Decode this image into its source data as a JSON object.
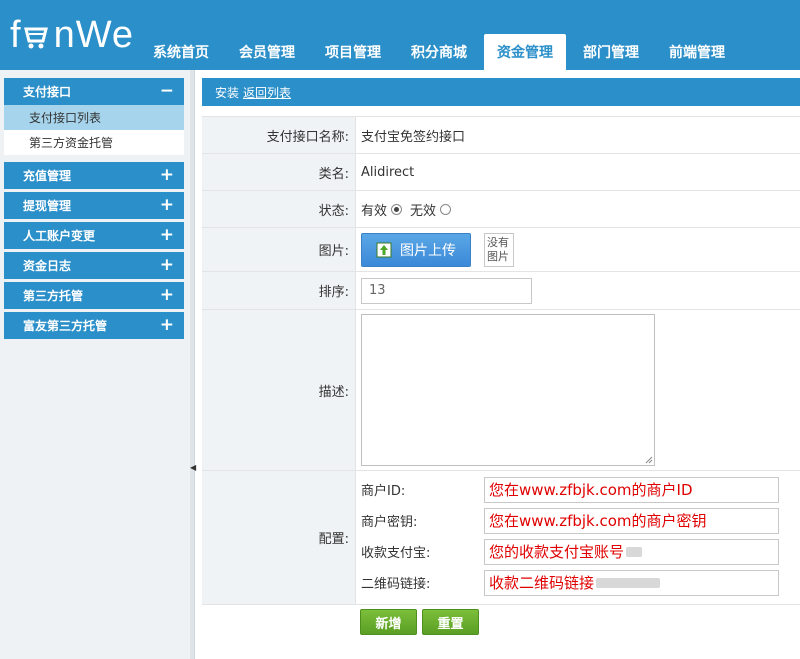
{
  "header": {
    "logo_text": "fanWe",
    "nav": [
      {
        "label": "系统首页",
        "active": false
      },
      {
        "label": "会员管理",
        "active": false
      },
      {
        "label": "项目管理",
        "active": false
      },
      {
        "label": "积分商城",
        "active": false
      },
      {
        "label": "资金管理",
        "active": true
      },
      {
        "label": "部门管理",
        "active": false
      },
      {
        "label": "前端管理",
        "active": false
      }
    ]
  },
  "sidebar": {
    "groups": [
      {
        "label": "支付接口",
        "sign": "−",
        "subs": [
          "支付接口列表",
          "第三方资金托管"
        ]
      },
      {
        "label": "充值管理",
        "sign": "+"
      },
      {
        "label": "提现管理",
        "sign": "+"
      },
      {
        "label": "人工账户变更",
        "sign": "+"
      },
      {
        "label": "资金日志",
        "sign": "+"
      },
      {
        "label": "第三方托管",
        "sign": "+"
      },
      {
        "label": "富友第三方托管",
        "sign": "+"
      }
    ]
  },
  "main": {
    "title_prefix": "安装",
    "back_link": "返回列表",
    "form": {
      "name_label": "支付接口名称:",
      "name_value": "支付宝免签约接口",
      "class_label": "类名:",
      "class_value": "Alidirect",
      "status_label": "状态:",
      "status_on": "有效",
      "status_off": "无效",
      "status_selected": "有效",
      "image_label": "图片:",
      "upload_label": "图片上传",
      "no_image_label": "没有图片",
      "sort_label": "排序:",
      "sort_value": "13",
      "desc_label": "描述:",
      "desc_value": "",
      "config_label": "配置:",
      "config": [
        {
          "label": "商户ID:",
          "value": "您在www.zfbjk.com的商户ID"
        },
        {
          "label": "商户密钥:",
          "value": "您在www.zfbjk.com的商户密钥"
        },
        {
          "label": "收款支付宝:",
          "value": "您的收款支付宝账号"
        },
        {
          "label": "二维码链接:",
          "value": "收款二维码链接"
        }
      ],
      "submit_label": "新增",
      "reset_label": "重置"
    }
  },
  "colors": {
    "brand_blue": "#2b8fc9",
    "sub_active": "#a6d4ec",
    "green_button": "#6aad2f",
    "config_text": "#e00000"
  }
}
